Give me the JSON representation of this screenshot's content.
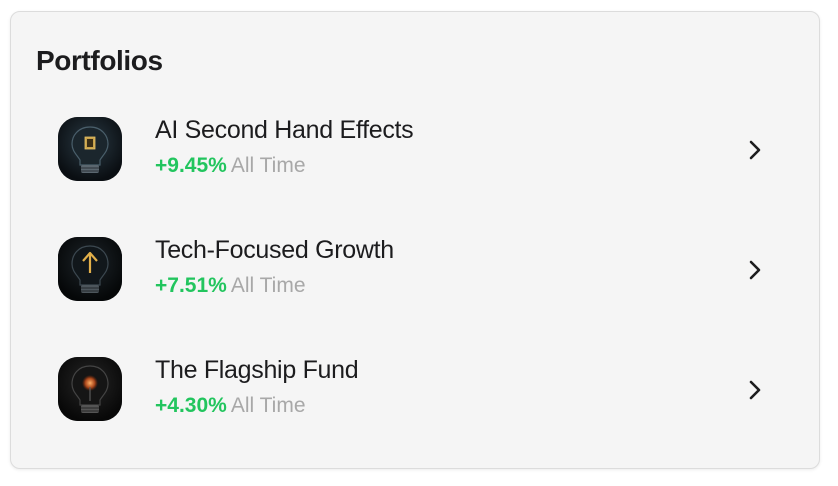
{
  "section": {
    "title": "Portfolios"
  },
  "portfolios": [
    {
      "name": "AI Second Hand Effects",
      "change": "+9.45%",
      "period": "All Time",
      "icon": "lightbulb-chip-icon",
      "accent_color": "#22c55e"
    },
    {
      "name": "Tech-Focused Growth",
      "change": "+7.51%",
      "period": "All Time",
      "icon": "lightbulb-arrow-icon",
      "accent_color": "#22c55e"
    },
    {
      "name": "The Flagship Fund",
      "change": "+4.30%",
      "period": "All Time",
      "icon": "lightbulb-glow-icon",
      "accent_color": "#22c55e"
    }
  ]
}
